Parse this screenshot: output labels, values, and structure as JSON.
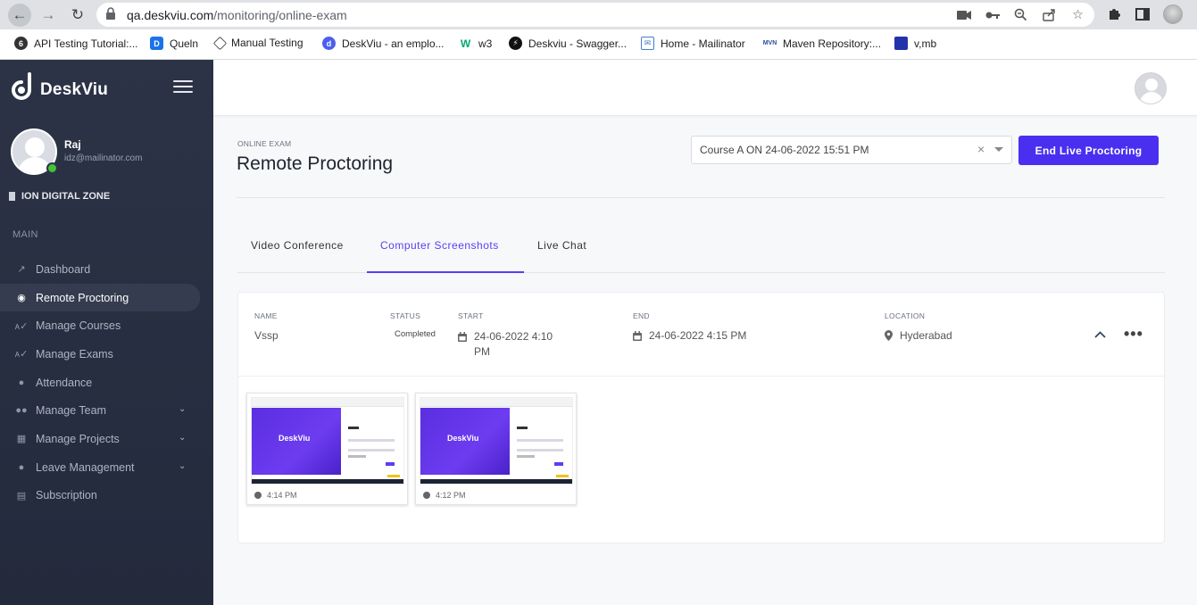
{
  "browser": {
    "url_host": "qa.deskviu.com",
    "url_path": "/monitoring/online-exam",
    "bookmarks": [
      {
        "label": "API Testing Tutorial:..."
      },
      {
        "label": "Queln"
      },
      {
        "label": "Manual Testing"
      },
      {
        "label": "DeskViu - an emplo..."
      },
      {
        "label": "w3"
      },
      {
        "label": "Deskviu - Swagger..."
      },
      {
        "label": "Home - Mailinator"
      },
      {
        "label": "Maven Repository:..."
      },
      {
        "label": "v,mb"
      }
    ]
  },
  "sidebar": {
    "brand": "DeskViu",
    "user": {
      "name": "Raj",
      "email": "idz@mailinator.com"
    },
    "org": "ION DIGITAL ZONE",
    "section": "MAIN",
    "items": [
      {
        "label": "Dashboard",
        "icon": "chart-icon"
      },
      {
        "label": "Remote Proctoring",
        "icon": "target-icon",
        "active": true
      },
      {
        "label": "Manage Courses",
        "icon": "spellcheck-icon"
      },
      {
        "label": "Manage Exams",
        "icon": "spellcheck-icon"
      },
      {
        "label": "Attendance",
        "icon": "user-check-icon"
      },
      {
        "label": "Manage Team",
        "icon": "users-icon",
        "expandable": true
      },
      {
        "label": "Manage Projects",
        "icon": "columns-icon",
        "expandable": true
      },
      {
        "label": "Leave Management",
        "icon": "globe-icon",
        "expandable": true
      },
      {
        "label": "Subscription",
        "icon": "document-icon"
      }
    ]
  },
  "header": {
    "breadcrumb": "ONLINE EXAM",
    "title": "Remote Proctoring",
    "course_select": {
      "value": "Course A ON 24-06-2022 15:51 PM",
      "clear": "×"
    },
    "end_button": "End Live Proctoring"
  },
  "tabs": [
    {
      "label": "Video Conference"
    },
    {
      "label": "Computer Screenshots",
      "active": true
    },
    {
      "label": "Live Chat"
    }
  ],
  "session": {
    "headers": {
      "name": "NAME",
      "status": "STATUS",
      "start": "START",
      "end": "END",
      "location": "LOCATION"
    },
    "name": "Vssp",
    "status": "Completed",
    "start_line1": "24-06-2022 4:10",
    "start_line2": "PM",
    "end": "24-06-2022 4:15 PM",
    "location": "Hyderabad",
    "more": "•••"
  },
  "screenshots": [
    {
      "time": "4:14 PM",
      "brand": "DeskViu"
    },
    {
      "time": "4:12 PM",
      "brand": "DeskViu"
    }
  ],
  "colors": {
    "accent": "#4b2ff0",
    "sidebar": "#2c3346",
    "online": "#45c236"
  }
}
